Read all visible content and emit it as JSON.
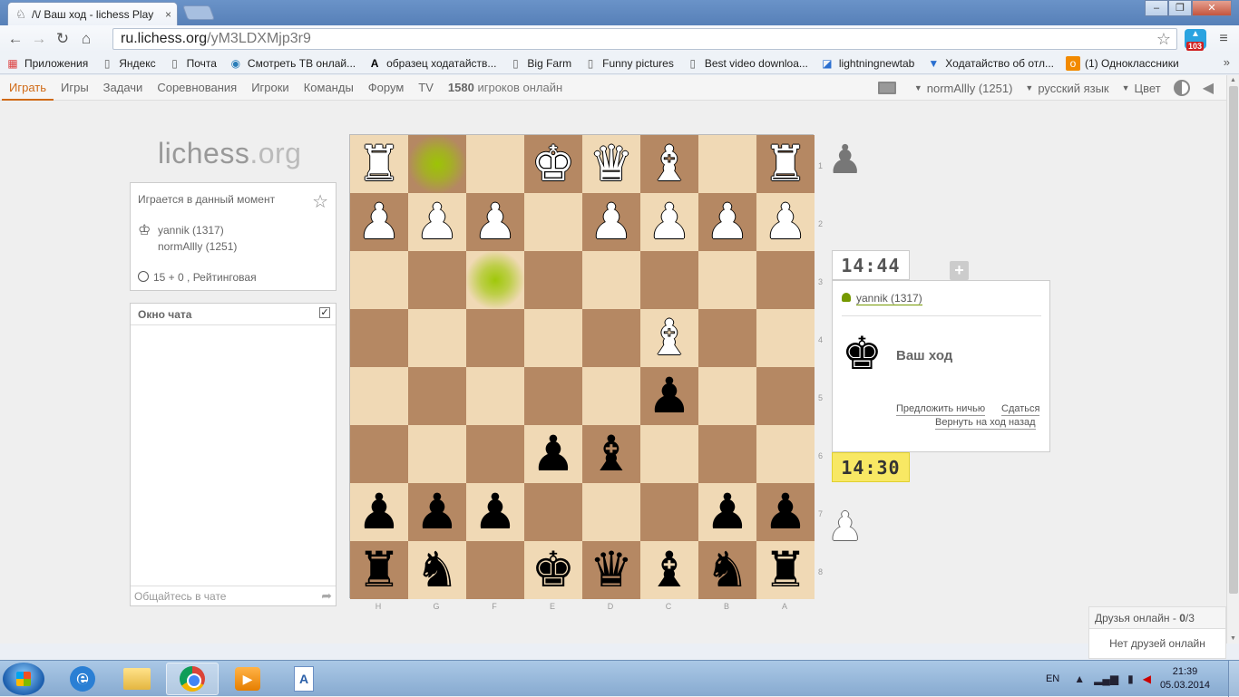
{
  "browser": {
    "tab_title": "/\\/ Ваш ход - lichess Play",
    "tab_close": "×",
    "url_host": "ru.lichess.org",
    "url_path": "/yM3LDXMjp3r9",
    "ext_badge": "103",
    "window_buttons": [
      "–",
      "❐",
      "✕"
    ]
  },
  "bookmarks": [
    {
      "label": "Приложения",
      "icon": "apps-grid-icon"
    },
    {
      "label": "Яндекс",
      "icon": "page-icon"
    },
    {
      "label": "Почта",
      "icon": "page-icon"
    },
    {
      "label": "Смотреть ТВ онлай...",
      "icon": "eye-icon"
    },
    {
      "label": "образец ходатайств...",
      "icon": "letter-a-icon"
    },
    {
      "label": "Big Farm",
      "icon": "page-icon"
    },
    {
      "label": "Funny pictures",
      "icon": "page-icon"
    },
    {
      "label": "Best video downloa...",
      "icon": "page-icon"
    },
    {
      "label": "lightningnewtab",
      "icon": "lightning-icon"
    },
    {
      "label": "Ходатайство об отл...",
      "icon": "shield-icon"
    },
    {
      "label": "(1) Одноклассники",
      "icon": "ok-icon"
    }
  ],
  "bookmarks_more": "»",
  "sitenav": {
    "items": [
      "Играть",
      "Игры",
      "Задачи",
      "Соревнования",
      "Игроки",
      "Команды",
      "Форум",
      "TV"
    ],
    "online_count": "1580",
    "online_label": "игроков онлайн",
    "user": "normAllly (1251)",
    "language": "русский язык",
    "color": "Цвет"
  },
  "logo": {
    "name": "lichess",
    "tld": ".org"
  },
  "current_game": {
    "header": "Играется в данный момент",
    "player1": "yannik (1317)",
    "player2": "normAllly (1251)",
    "mode": "15 + 0 , Рейтинговая"
  },
  "chat": {
    "header": "Окно чата",
    "checkbox": "✓",
    "placeholder": "Общайтесь в чате"
  },
  "board": {
    "rank_labels": [
      "1",
      "2",
      "3",
      "4",
      "5",
      "6",
      "7",
      "8"
    ],
    "file_labels": [
      "H",
      "G",
      "F",
      "E",
      "D",
      "C",
      "B",
      "A"
    ],
    "light_color": "#f0d9b5",
    "dark_color": "#b58863",
    "highlights": [
      [
        0,
        1
      ],
      [
        2,
        2
      ]
    ],
    "rows": [
      [
        "wR",
        "",
        "",
        "wK",
        "wQ",
        "wB",
        "",
        "wR"
      ],
      [
        "wP",
        "wP",
        "wP",
        "",
        "wP",
        "wP",
        "wP",
        "wP"
      ],
      [
        "",
        "",
        "",
        "",
        "",
        "",
        "",
        ""
      ],
      [
        "",
        "",
        "",
        "",
        "",
        "wB",
        "",
        ""
      ],
      [
        "",
        "",
        "",
        "",
        "",
        "bP",
        "",
        ""
      ],
      [
        "",
        "",
        "",
        "bP",
        "bB",
        "",
        "",
        ""
      ],
      [
        "bP",
        "bP",
        "bP",
        "",
        "",
        "",
        "bP",
        "bP"
      ],
      [
        "bR",
        "bN",
        "",
        "bK",
        "bQ",
        "bB",
        "bN",
        "bR"
      ]
    ]
  },
  "game": {
    "opponent_clock": "14:44",
    "my_clock": "14:30",
    "opponent": "yannik (1317)",
    "turn_text": "Ваш ход",
    "offer_draw": "Предложить ничью",
    "resign": "Сдаться",
    "takeback": "Вернуть на ход назад",
    "plus": "+"
  },
  "friends": {
    "header_label": "Друзья онлайн - ",
    "online": "0",
    "total": "/3",
    "empty": "Нет друзей онлайн"
  },
  "taskbar": {
    "lang": "EN",
    "time": "21:39",
    "date": "05.03.2014"
  }
}
